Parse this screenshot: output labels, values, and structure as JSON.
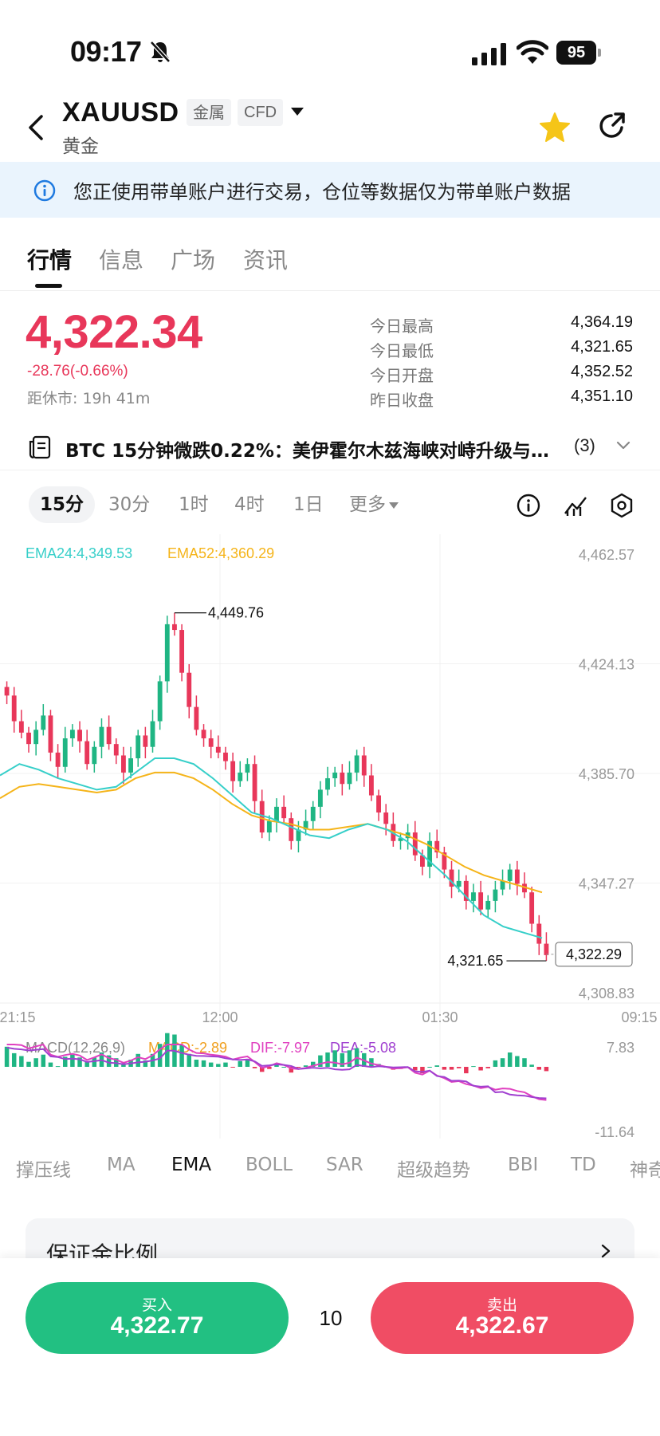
{
  "status_bar": {
    "time": "09:17",
    "battery": "95"
  },
  "header": {
    "symbol": "XAUUSD",
    "tags": [
      "金属",
      "CFD"
    ],
    "name": "黄金"
  },
  "notice": {
    "text": "您正使用带单账户进行交易，仓位等数据仅为带单账户数据"
  },
  "tabs": [
    {
      "label": "行情",
      "active": true
    },
    {
      "label": "信息",
      "active": false
    },
    {
      "label": "广场",
      "active": false
    },
    {
      "label": "资讯",
      "active": false
    }
  ],
  "quote": {
    "price": "4,322.34",
    "change": "-28.76(-0.66%)",
    "close_countdown": "距休市: 19h 41m",
    "stats": [
      {
        "label": "今日最高",
        "value": "4,364.19"
      },
      {
        "label": "今日最低",
        "value": "4,321.65"
      },
      {
        "label": "今日开盘",
        "value": "4,352.52"
      },
      {
        "label": "昨日收盘",
        "value": "4,351.10"
      }
    ]
  },
  "news": {
    "text": "BTC 15分钟微跌0.22%：美伊霍尔木兹海峡对峙升级与…",
    "count": "(3)"
  },
  "timeframes": [
    {
      "label": "15分",
      "active": true
    },
    {
      "label": "30分",
      "active": false
    },
    {
      "label": "1时",
      "active": false
    },
    {
      "label": "4时",
      "active": false
    },
    {
      "label": "1日",
      "active": false
    },
    {
      "label": "更多",
      "active": false
    }
  ],
  "chart_data": [
    {
      "type": "candlestick",
      "ema_labels": {
        "ema24": "EMA24:4,349.53",
        "ema52": "EMA52:4,360.29"
      },
      "colors": {
        "up": "#1fb583",
        "down": "#e8375a",
        "ema24": "#36cfc9",
        "ema52": "#f5b419",
        "macd": "#f0a020",
        "dif": "#e040c0",
        "dea": "#a040d0"
      },
      "y_ticks": [
        "4,462.57",
        "4,424.13",
        "4,385.70",
        "4,347.27",
        "4,308.83"
      ],
      "ylim": [
        4308.83,
        4462.57
      ],
      "x_ticks": [
        "21:15",
        "12:00",
        "01:30",
        "09:15"
      ],
      "high_marker": "4,449.76",
      "low_marker": "4,321.65",
      "last_price": "4,322.29",
      "ema24": [
        4385,
        4389,
        4387,
        4384,
        4382,
        4380,
        4381,
        4386,
        4391,
        4391,
        4389,
        4384,
        4378,
        4372,
        4370,
        4367,
        4364,
        4363,
        4366,
        4368,
        4366,
        4362,
        4356,
        4350,
        4343,
        4336,
        4332,
        4330,
        4328
      ],
      "ema52": [
        4377,
        4381,
        4382,
        4381,
        4380,
        4379,
        4380,
        4384,
        4386,
        4386,
        4384,
        4380,
        4375,
        4371,
        4369,
        4368,
        4366,
        4366,
        4367,
        4368,
        4366,
        4364,
        4361,
        4357,
        4353,
        4350,
        4348,
        4346,
        4344
      ],
      "candles_close": [
        4413,
        4404,
        4400,
        4396,
        4401,
        4406,
        4393,
        4388,
        4398,
        4401,
        4397,
        4389,
        4395,
        4402,
        4396,
        4392,
        4386,
        4391,
        4399,
        4395,
        4404,
        4418,
        4438,
        4436,
        4421,
        4409,
        4401,
        4398,
        4395,
        4393,
        4390,
        4383,
        4386,
        4389,
        4376,
        4365,
        4369,
        4374,
        4370,
        4362,
        4366,
        4369,
        4374,
        4380,
        4384,
        4386,
        4382,
        4386,
        4392,
        4385,
        4378,
        4372,
        4368,
        4362,
        4363,
        4365,
        4357,
        4353,
        4362,
        4358,
        4352,
        4346,
        4348,
        4341,
        4344,
        4338,
        4341,
        4345,
        4348,
        4352,
        4347,
        4344,
        4333,
        4326,
        4322
      ]
    },
    {
      "type": "bar",
      "title": "MACD(12,26,9)",
      "macd_label": "MACD:-2.89",
      "dif_label": "DIF:-7.97",
      "dea_label": "DEA:-5.08",
      "y_ticks": [
        "7.83",
        "-11.64"
      ],
      "ylim": [
        -11.64,
        7.83
      ]
    }
  ],
  "indicators": [
    {
      "label": "撑压线",
      "active": false
    },
    {
      "label": "MA",
      "active": false
    },
    {
      "label": "EMA",
      "active": true
    },
    {
      "label": "BOLL",
      "active": false
    },
    {
      "label": "SAR",
      "active": false
    },
    {
      "label": "超级趋势",
      "active": false
    },
    {
      "label": "BBI",
      "active": false
    },
    {
      "label": "TD",
      "active": false
    },
    {
      "label": "神奇",
      "active": false
    }
  ],
  "margin_card": {
    "label": "保证金比例"
  },
  "trade": {
    "buy_label": "买入",
    "buy_price": "4,322.77",
    "lot": "10",
    "sell_label": "卖出",
    "sell_price": "4,322.67"
  }
}
